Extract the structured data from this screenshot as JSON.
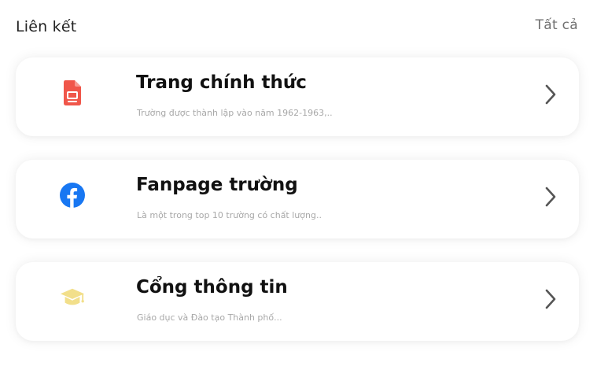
{
  "header": {
    "title": "Liên kết",
    "see_all": "Tất cả"
  },
  "links": [
    {
      "title": "Trang chính thức",
      "description": "Trường được thành lập vào năm 1962-1963,..",
      "icon": "document-icon",
      "icon_color": "#f0564a"
    },
    {
      "title": "Fanpage trường",
      "description": "Là một trong top 10 trường có chất lượng..",
      "icon": "facebook-icon",
      "icon_color": "#1877f2"
    },
    {
      "title": "Cổng thông tin",
      "description": "Giáo dục và Đào tạo Thành phố...",
      "icon": "graduation-cap-icon",
      "icon_color": "#f2df8a"
    }
  ]
}
